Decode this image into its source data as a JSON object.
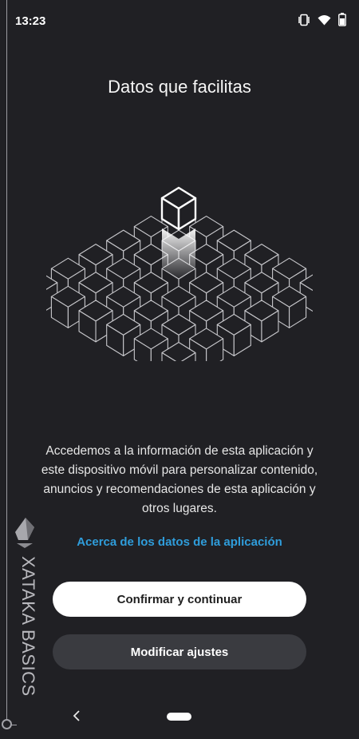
{
  "status": {
    "time": "13:23",
    "icons": [
      "vibrate-icon",
      "wifi-icon",
      "battery-icon"
    ]
  },
  "screen": {
    "title": "Datos que facilitas",
    "description": "Accedemos a la información de esta aplicación y este dispositivo móvil para personalizar contenido, anuncios y recomendaciones de esta aplicación y otros lugares.",
    "link": "Acerca de los datos de la aplicación",
    "primary_button": "Confirmar y continuar",
    "secondary_button": "Modificar ajustes"
  },
  "watermark": {
    "text": "XATAKA BASICS"
  },
  "colors": {
    "background": "#202024",
    "link": "#2f9ddb",
    "primary_button_bg": "#ffffff",
    "secondary_button_bg": "#3a3b40"
  },
  "nav": {
    "icons": [
      "back-icon",
      "home-pill"
    ]
  }
}
